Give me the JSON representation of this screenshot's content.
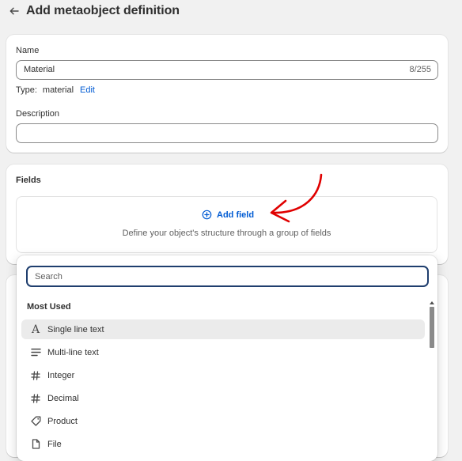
{
  "header": {
    "title": "Add metaobject definition",
    "back_icon": "arrow-left-icon"
  },
  "definition": {
    "name_label": "Name",
    "name_value": "Material",
    "name_counter": "8/255",
    "type_label": "Type:",
    "type_value": "material",
    "edit_link": "Edit",
    "description_label": "Description",
    "description_value": ""
  },
  "fields": {
    "title": "Fields",
    "add_field_label": "Add field",
    "add_field_icon": "plus-circle-icon",
    "empty_description": "Define your object's structure through a group of fields"
  },
  "picker": {
    "search_placeholder": "Search",
    "section_title": "Most Used",
    "items": [
      {
        "label": "Single line text",
        "icon": "text-icon",
        "selected": true
      },
      {
        "label": "Multi-line text",
        "icon": "paragraph-icon",
        "selected": false
      },
      {
        "label": "Integer",
        "icon": "hash-icon",
        "selected": false
      },
      {
        "label": "Decimal",
        "icon": "hash-icon",
        "selected": false
      },
      {
        "label": "Product",
        "icon": "tag-icon",
        "selected": false
      },
      {
        "label": "File",
        "icon": "file-icon",
        "selected": false
      }
    ]
  },
  "colors": {
    "link": "#005bd3",
    "annotation_arrow": "#e00000",
    "search_focus": "#1f3e6e",
    "selected_row": "#ebebeb"
  }
}
